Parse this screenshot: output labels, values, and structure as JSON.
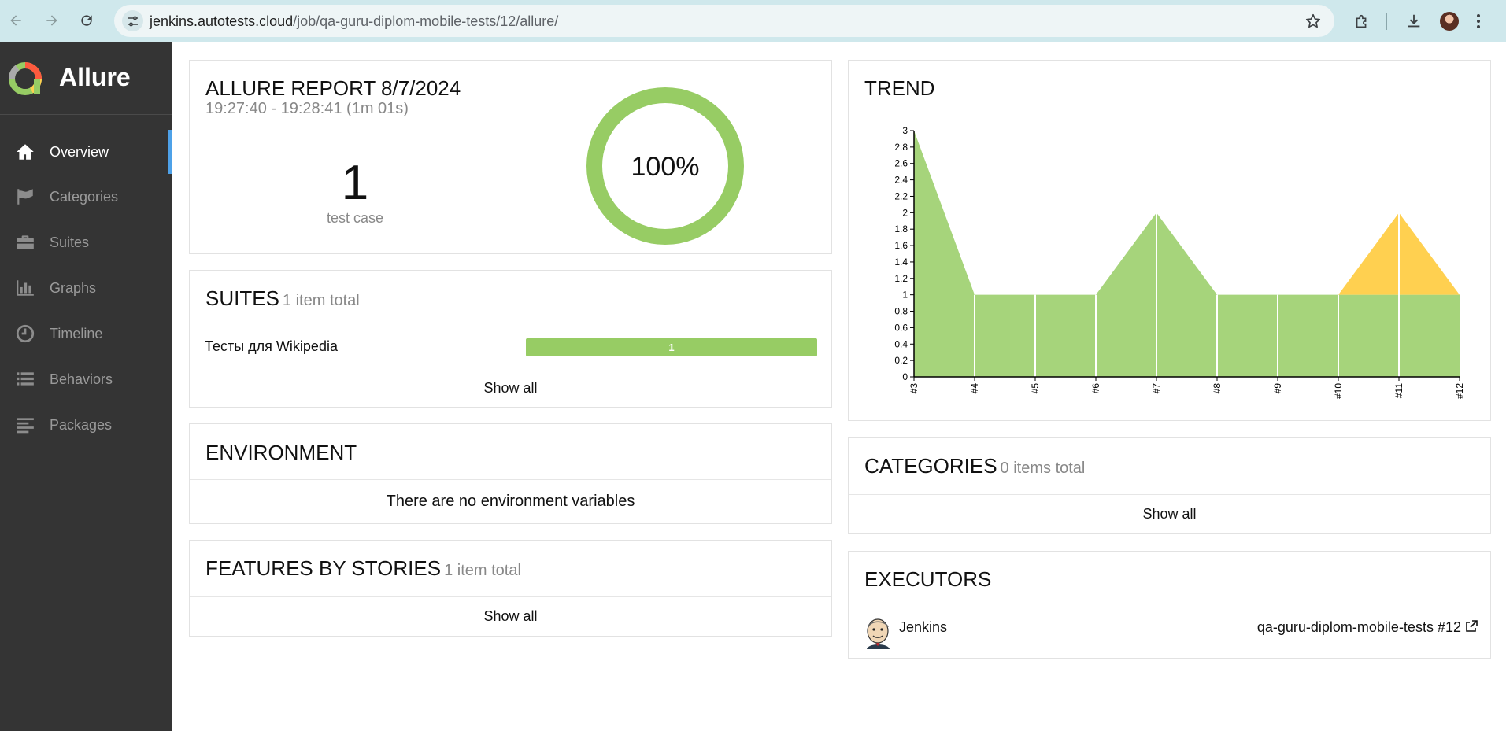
{
  "browser": {
    "url_domain": "jenkins.autotests.cloud",
    "url_path": "/job/qa-guru-diplom-mobile-tests/12/allure/"
  },
  "sidebar": {
    "brand": "Allure",
    "items": [
      {
        "label": "Overview",
        "icon": "home-icon",
        "active": true
      },
      {
        "label": "Categories",
        "icon": "flag-icon"
      },
      {
        "label": "Suites",
        "icon": "briefcase-icon"
      },
      {
        "label": "Graphs",
        "icon": "bar-chart-icon"
      },
      {
        "label": "Timeline",
        "icon": "clock-icon"
      },
      {
        "label": "Behaviors",
        "icon": "list-icon"
      },
      {
        "label": "Packages",
        "icon": "align-left-icon"
      }
    ]
  },
  "summary": {
    "title": "ALLURE REPORT 8/7/2024",
    "time_range": "19:27:40 - 19:28:41 (1m 01s)",
    "count": "1",
    "count_label": "test case",
    "percent": "100%",
    "passed_fraction": 1.0
  },
  "suites": {
    "title": "SUITES",
    "total": "1 item total",
    "rows": [
      {
        "name": "Тесты для Wikipedia",
        "passed": "1"
      }
    ],
    "show_all": "Show all"
  },
  "environment": {
    "title": "ENVIRONMENT",
    "empty_text": "There are no environment variables"
  },
  "features": {
    "title": "FEATURES BY STORIES",
    "total": "1 item total",
    "show_all": "Show all"
  },
  "trend": {
    "title": "TREND"
  },
  "categories": {
    "title": "CATEGORIES",
    "total": "0 items total",
    "show_all": "Show all"
  },
  "executors": {
    "title": "EXECUTORS",
    "name": "Jenkins",
    "build": "qa-guru-diplom-mobile-tests #12"
  },
  "colors": {
    "passed": "#97cc64",
    "broken": "#ffd050",
    "sidebar_bg": "#343434",
    "active_accent": "#4ea1e8"
  },
  "chart_data": {
    "type": "area",
    "title": "TREND",
    "x": [
      "#3",
      "#4",
      "#5",
      "#6",
      "#7",
      "#8",
      "#9",
      "#10",
      "#11",
      "#12"
    ],
    "series": [
      {
        "values": [
          3,
          1,
          1,
          1,
          2,
          1,
          1,
          1,
          1,
          1
        ],
        "color": "#97cc64"
      },
      {
        "values": [
          0,
          0,
          0,
          0,
          0,
          0,
          0,
          0,
          1,
          0
        ],
        "color": "#ffd050"
      }
    ],
    "y_ticks": [
      "0",
      "0.2",
      "0.4",
      "0.6",
      "0.8",
      "1",
      "1.2",
      "1.4",
      "1.6",
      "1.8",
      "2",
      "2.2",
      "2.4",
      "2.6",
      "2.8",
      "3"
    ],
    "ylim": [
      0,
      3
    ],
    "stacked": true,
    "grid": false
  }
}
